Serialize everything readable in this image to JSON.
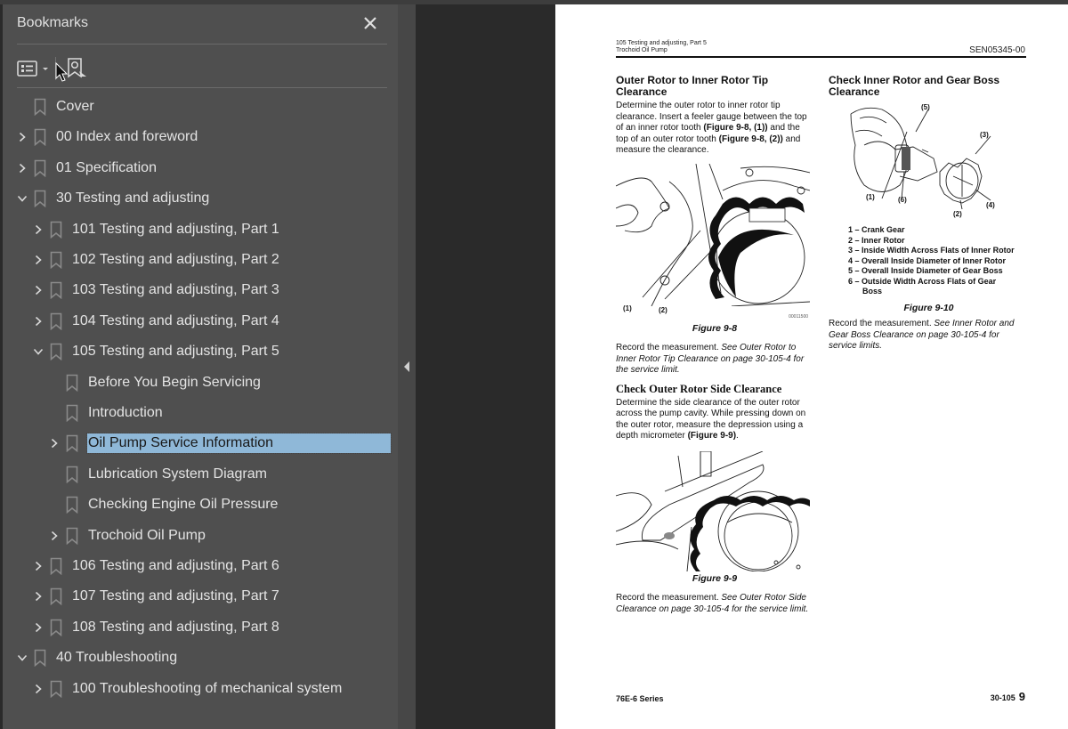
{
  "bookmarks_panel": {
    "title": "Bookmarks",
    "close_icon": "close-icon",
    "toolbar": {
      "options_icon": "list-options-icon",
      "options_dropdown_icon": "chevron-down-icon",
      "find_current_icon": "find-current-bookmark-icon"
    },
    "items": [
      {
        "label": "Cover",
        "level": 0,
        "expander": "none"
      },
      {
        "label": "00 Index and foreword",
        "level": 0,
        "expander": "collapsed"
      },
      {
        "label": "01 Specification",
        "level": 0,
        "expander": "collapsed"
      },
      {
        "label": "30 Testing and adjusting",
        "level": 0,
        "expander": "expanded"
      },
      {
        "label": "101 Testing and adjusting, Part 1",
        "level": 1,
        "expander": "collapsed"
      },
      {
        "label": "102 Testing and adjusting, Part 2",
        "level": 1,
        "expander": "collapsed"
      },
      {
        "label": "103 Testing and adjusting, Part 3",
        "level": 1,
        "expander": "collapsed"
      },
      {
        "label": "104 Testing and adjusting, Part 4",
        "level": 1,
        "expander": "collapsed"
      },
      {
        "label": "105 Testing and adjusting, Part 5",
        "level": 1,
        "expander": "expanded"
      },
      {
        "label": "Before You Begin Servicing",
        "level": 2,
        "expander": "none"
      },
      {
        "label": "Introduction",
        "level": 2,
        "expander": "none"
      },
      {
        "label": "Oil Pump Service Information",
        "level": 2,
        "expander": "collapsed",
        "selected": true
      },
      {
        "label": "Lubrication System Diagram",
        "level": 2,
        "expander": "none"
      },
      {
        "label": "Checking Engine Oil Pressure",
        "level": 2,
        "expander": "none"
      },
      {
        "label": "Trochoid Oil Pump",
        "level": 2,
        "expander": "collapsed"
      },
      {
        "label": "106 Testing and adjusting, Part 6",
        "level": 1,
        "expander": "collapsed"
      },
      {
        "label": "107 Testing and adjusting, Part 7",
        "level": 1,
        "expander": "collapsed"
      },
      {
        "label": "108 Testing and adjusting, Part 8",
        "level": 1,
        "expander": "collapsed"
      },
      {
        "label": "40 Troubleshooting",
        "level": 0,
        "expander": "expanded"
      },
      {
        "label": "100 Troubleshooting of mechanical system",
        "level": 1,
        "expander": "collapsed"
      }
    ]
  },
  "colors": {
    "panel_bg": "#4f4f4f",
    "viewport_bg": "#2a2a2a",
    "selection_bg": "#8fb8d8",
    "text": "#e4e4e4"
  },
  "document": {
    "header": {
      "section": "105 Testing and adjusting, Part 5",
      "subsection": "Trochoid Oil Pump",
      "doc_number": "SEN05345-00"
    },
    "left_column": {
      "heading1": "Outer Rotor to Inner Rotor Tip Clearance",
      "para1_a": "Determine the outer rotor to inner rotor tip clearance. Insert a feeler gauge between the top of an inner rotor tooth ",
      "para1_ref1": "(Figure 9-8, (1))",
      "para1_b": " and the top of an outer rotor tooth ",
      "para1_ref2": "(Figure 9-8, (2))",
      "para1_c": " and measure the clearance.",
      "fig1_callout1": "(1)",
      "fig1_callout2": "(2)",
      "fig1_id": "00011500",
      "fig1_caption": "Figure 9-8",
      "para2_a": "Record the measurement. ",
      "para2_b": "See Outer Rotor to Inner Rotor Tip Clearance on page 30-105-4 for the service limit.",
      "heading2": "Check Outer Rotor Side Clearance",
      "para3_a": "Determine the side clearance of the outer rotor across the pump cavity. While pressing down on the outer rotor, measure the depression using a depth micrometer ",
      "para3_ref": "(Figure 9-9)",
      "para3_c": ".",
      "fig2_caption": "Figure 9-9",
      "para4_a": "Record the measurement. ",
      "para4_b": "See Outer Rotor Side Clearance on page 30-105-4 for the service limit."
    },
    "right_column": {
      "heading": "Check Inner Rotor and Gear Boss Clearance",
      "callouts": [
        "(1)",
        "(2)",
        "(3)",
        "(4)",
        "(5)",
        "(6)"
      ],
      "legend": [
        "1 – Crank Gear",
        "2 – Inner Rotor",
        "3 – Inside Width Across Flats of Inner Rotor",
        "4 – Overall Inside Diameter of Inner Rotor",
        "5 – Overall Inside Diameter of Gear Boss",
        "6 – Outside Width Across Flats of Gear",
        "Boss"
      ],
      "fig_caption": "Figure 9-10",
      "para_a": "Record the measurement. ",
      "para_b": "See Inner Rotor and Gear Boss Clearance on page 30-105-4 for service limits."
    },
    "footer": {
      "series": "76E-6 Series",
      "section_page": "30-105",
      "page_number": "9"
    }
  }
}
